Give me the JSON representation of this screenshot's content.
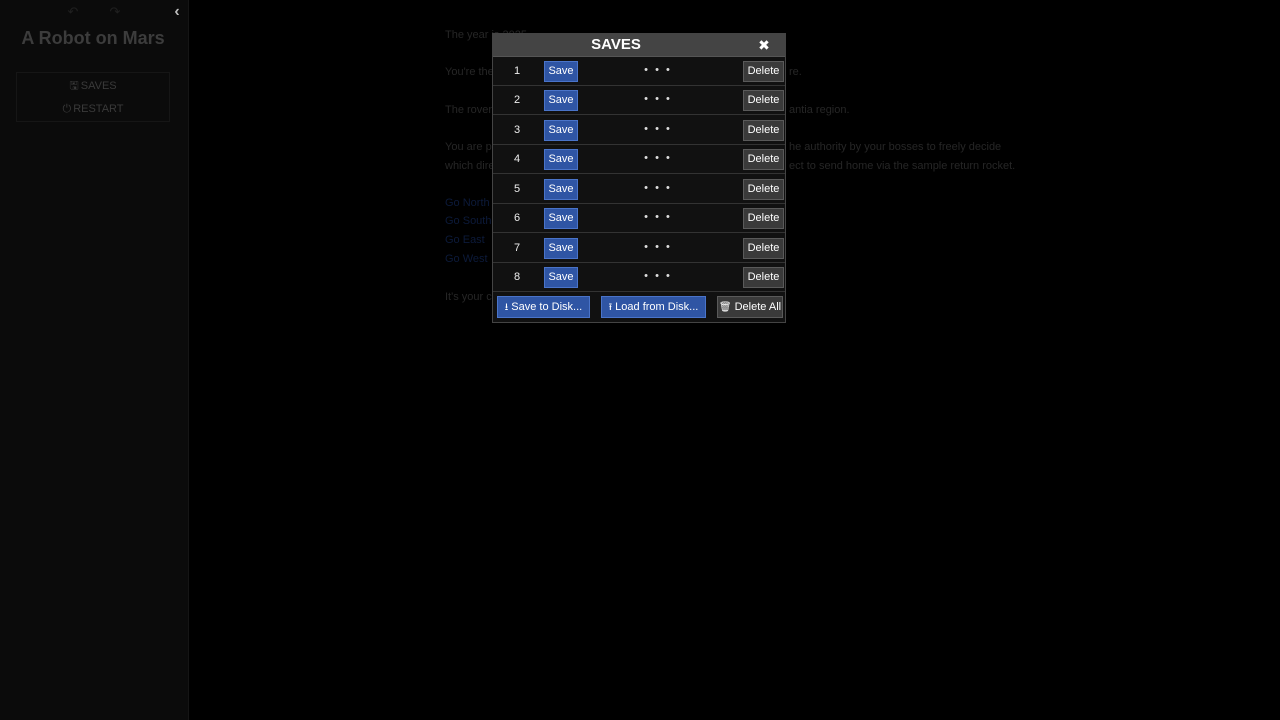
{
  "sidebar": {
    "title": "A Robot on Mars",
    "toggle_icon": "chevron-left-icon",
    "history_back_icon": "undo-icon",
    "history_forward_icon": "redo-icon",
    "menu": {
      "saves_label": "SAVES",
      "restart_label": "RESTART",
      "saves_icon": "floppy-disk-icon",
      "restart_icon": "power-icon"
    }
  },
  "story": {
    "lines": [
      "The year is 2025.",
      "You're the",
      "re.",
      "The rover",
      "antia region.",
      "You are p",
      "he authority by your bosses to freely decide",
      "which dire",
      "ect to send home via the sample return rocket.",
      "It's your c"
    ],
    "links": [
      "Go North",
      "Go South",
      "Go East",
      "Go West"
    ]
  },
  "dialog": {
    "title": "SAVES",
    "close_icon": "close-icon",
    "slots": [
      {
        "number": "1",
        "save_label": "Save",
        "description": "• • •",
        "delete_label": "Delete"
      },
      {
        "number": "2",
        "save_label": "Save",
        "description": "• • •",
        "delete_label": "Delete"
      },
      {
        "number": "3",
        "save_label": "Save",
        "description": "• • •",
        "delete_label": "Delete"
      },
      {
        "number": "4",
        "save_label": "Save",
        "description": "• • •",
        "delete_label": "Delete"
      },
      {
        "number": "5",
        "save_label": "Save",
        "description": "• • •",
        "delete_label": "Delete"
      },
      {
        "number": "6",
        "save_label": "Save",
        "description": "• • •",
        "delete_label": "Delete"
      },
      {
        "number": "7",
        "save_label": "Save",
        "description": "• • •",
        "delete_label": "Delete"
      },
      {
        "number": "8",
        "save_label": "Save",
        "description": "• • •",
        "delete_label": "Delete"
      }
    ],
    "footer": {
      "save_to_disk_label": "Save to Disk...",
      "load_from_disk_label": "Load from Disk...",
      "delete_all_label": "Delete All",
      "save_to_disk_icon": "download-icon",
      "load_from_disk_icon": "upload-icon",
      "delete_all_icon": "trash-icon"
    }
  },
  "colors": {
    "primary_button": "#2f55a4",
    "secondary_button": "#3a3a3a",
    "titlebar": "#444444",
    "dialog_bg": "#111111"
  }
}
